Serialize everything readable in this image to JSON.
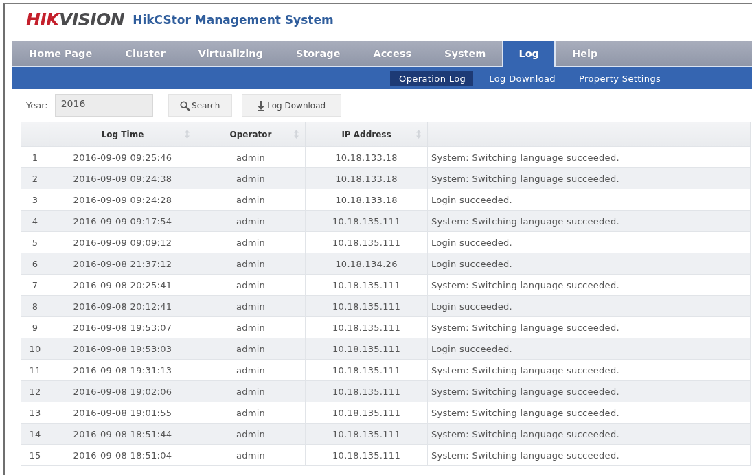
{
  "header": {
    "logo": {
      "parts": [
        "HIK",
        "VISION"
      ]
    },
    "title": "HikCStor Management System"
  },
  "nav_tabs": [
    {
      "label": "Home Page",
      "selected": false
    },
    {
      "label": "Cluster",
      "selected": false
    },
    {
      "label": "Virtualizing",
      "selected": false
    },
    {
      "label": "Storage",
      "selected": false
    },
    {
      "label": "Access",
      "selected": false
    },
    {
      "label": "System",
      "selected": false
    },
    {
      "label": "Log",
      "selected": true
    },
    {
      "label": "Help",
      "selected": false
    }
  ],
  "sub_tabs": [
    {
      "label": "Operation Log",
      "selected": true
    },
    {
      "label": "Log Download",
      "selected": false
    },
    {
      "label": "Property Settings",
      "selected": false
    }
  ],
  "toolbar": {
    "year_label": "Year:",
    "year_field": {
      "value": "2016"
    },
    "buttons": [
      {
        "kind": "search",
        "label": "Search"
      },
      {
        "kind": "download",
        "label": "Log Download"
      }
    ]
  },
  "table": {
    "columns": [
      {
        "sortable": false
      },
      {
        "label": "Log Time",
        "sortable": true
      },
      {
        "label": "Operator",
        "sortable": true
      },
      {
        "label": "IP Address",
        "sortable": true
      },
      {
        "sortable": false
      }
    ],
    "rows": [
      {
        "cells": [
          "1",
          "2016-09-09 09:25:46",
          "admin",
          "10.18.133.18",
          "System: Switching language succeeded."
        ]
      },
      {
        "cells": [
          "2",
          "2016-09-09 09:24:38",
          "admin",
          "10.18.133.18",
          "System: Switching language succeeded."
        ]
      },
      {
        "cells": [
          "3",
          "2016-09-09 09:24:28",
          "admin",
          "10.18.133.18",
          "Login succeeded."
        ]
      },
      {
        "cells": [
          "4",
          "2016-09-09 09:17:54",
          "admin",
          "10.18.135.111",
          "System: Switching language succeeded."
        ]
      },
      {
        "cells": [
          "5",
          "2016-09-09 09:09:12",
          "admin",
          "10.18.135.111",
          "Login succeeded."
        ]
      },
      {
        "cells": [
          "6",
          "2016-09-08 21:37:12",
          "admin",
          "10.18.134.26",
          "Login succeeded."
        ]
      },
      {
        "cells": [
          "7",
          "2016-09-08 20:25:41",
          "admin",
          "10.18.135.111",
          "System: Switching language succeeded."
        ]
      },
      {
        "cells": [
          "8",
          "2016-09-08 20:12:41",
          "admin",
          "10.18.135.111",
          "Login succeeded."
        ]
      },
      {
        "cells": [
          "9",
          "2016-09-08 19:53:07",
          "admin",
          "10.18.135.111",
          "System: Switching language succeeded."
        ]
      },
      {
        "cells": [
          "10",
          "2016-09-08 19:53:03",
          "admin",
          "10.18.135.111",
          "Login succeeded."
        ]
      },
      {
        "cells": [
          "11",
          "2016-09-08 19:31:13",
          "admin",
          "10.18.135.111",
          "System: Switching language succeeded."
        ]
      },
      {
        "cells": [
          "12",
          "2016-09-08 19:02:06",
          "admin",
          "10.18.135.111",
          "System: Switching language succeeded."
        ]
      },
      {
        "cells": [
          "13",
          "2016-09-08 19:01:55",
          "admin",
          "10.18.135.111",
          "System: Switching language succeeded."
        ]
      },
      {
        "cells": [
          "14",
          "2016-09-08 18:51:44",
          "admin",
          "10.18.135.111",
          "System: Switching language succeeded."
        ]
      },
      {
        "cells": [
          "15",
          "2016-09-08 18:51:04",
          "admin",
          "10.18.135.111",
          "System: Switching language succeeded."
        ]
      }
    ]
  }
}
